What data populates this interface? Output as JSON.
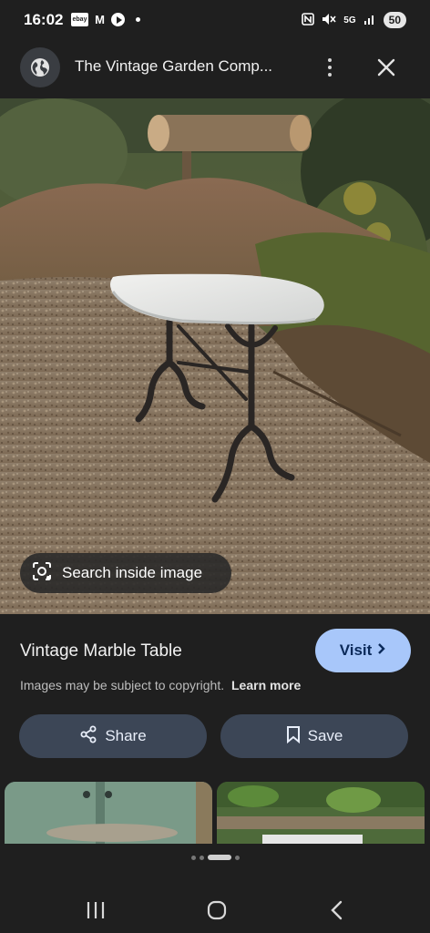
{
  "status_bar": {
    "time": "16:02",
    "ebay_icon_text": "ebay",
    "mail_icon_text": "M",
    "network": "5G",
    "battery": "50"
  },
  "app_bar": {
    "title": "The Vintage Garden Comp..."
  },
  "image": {
    "search_inside_label": "Search inside image"
  },
  "details": {
    "title": "Vintage Marble Table",
    "visit_label": "Visit",
    "copyright_text": "Images may be subject to copyright.",
    "learn_more": "Learn more",
    "share_label": "Share",
    "save_label": "Save"
  },
  "colors": {
    "background": "#1f1f1f",
    "visit_button": "#a8c7fa",
    "action_button": "#3c4656"
  },
  "icons": [
    "globe-icon",
    "more-vert-icon",
    "close-icon",
    "lens-icon",
    "chevron-right-icon",
    "share-icon",
    "bookmark-icon",
    "recent-apps-icon",
    "home-icon",
    "back-icon"
  ]
}
